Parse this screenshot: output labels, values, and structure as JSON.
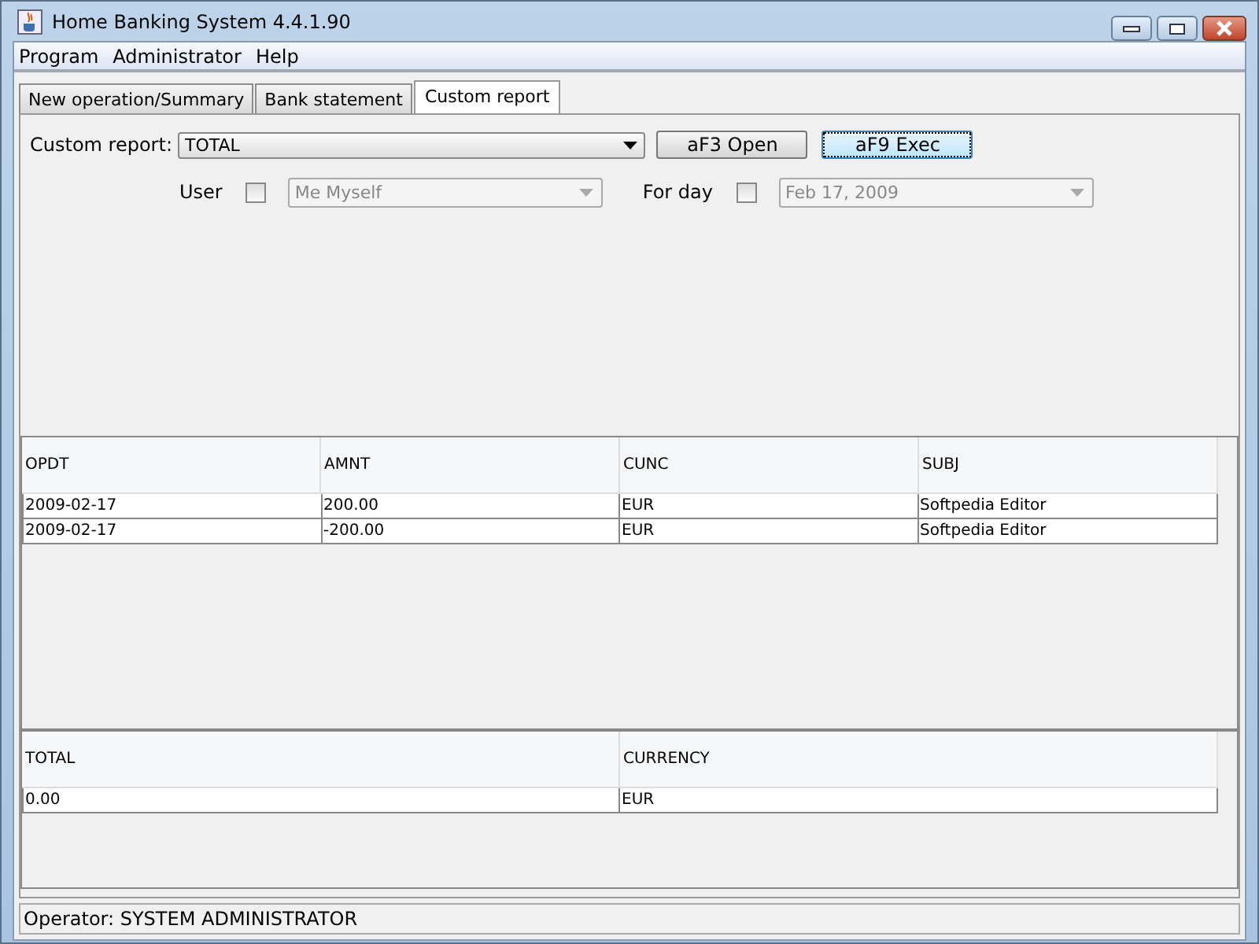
{
  "window": {
    "title": "Home Banking System 4.4.1.90"
  },
  "menu": [
    "Program",
    "Administrator",
    "Help"
  ],
  "tabs": [
    {
      "label": "New operation/Summary",
      "selected": false
    },
    {
      "label": "Bank statement",
      "selected": false
    },
    {
      "label": "Custom report",
      "selected": true
    }
  ],
  "report": {
    "label": "Custom report:",
    "value": "TOTAL"
  },
  "buttons": [
    {
      "label": "aF3 Open",
      "focused": false
    },
    {
      "label": "aF9 Exec",
      "focused": true
    }
  ],
  "filters": [
    {
      "label": "User",
      "checked": false,
      "value": "Me Myself",
      "disabled": true
    },
    {
      "label": "For day",
      "checked": false,
      "value": "Feb 17, 2009",
      "disabled": true
    }
  ],
  "table": {
    "columns": [
      "OPDT",
      "AMNT",
      "CUNC",
      "SUBJ"
    ],
    "rows": [
      [
        "2009-02-17",
        "200.00",
        "EUR",
        "Softpedia Editor"
      ],
      [
        "2009-02-17",
        "-200.00",
        "EUR",
        "Softpedia Editor"
      ]
    ]
  },
  "totals": {
    "columns": [
      "TOTAL",
      "CURRENCY"
    ],
    "rows": [
      [
        "0.00",
        "EUR"
      ]
    ]
  },
  "status_bar": "Operator: SYSTEM ADMINISTRATOR"
}
